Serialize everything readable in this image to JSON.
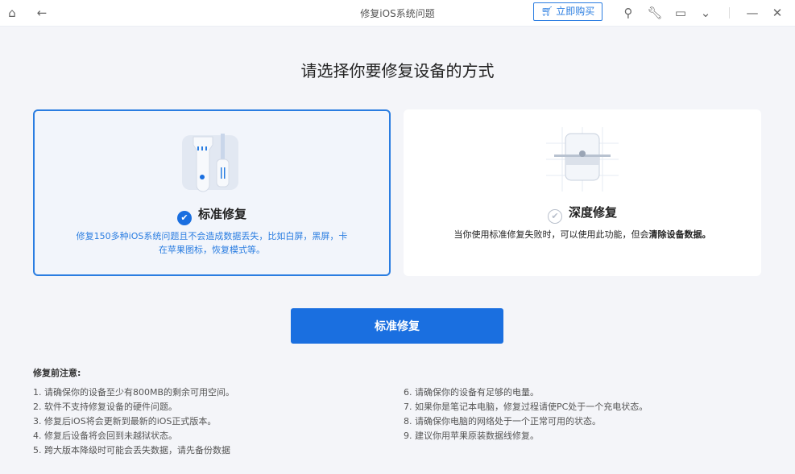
{
  "titlebar": {
    "title": "修复iOS系统问题",
    "buy_label": "立即购买",
    "icons": [
      "home-icon",
      "back-icon",
      "cart-icon",
      "key-icon",
      "wrench-icon",
      "feedback-icon",
      "chevron-down-icon",
      "minimize-icon",
      "close-icon"
    ]
  },
  "heading": "请选择你要修复设备的方式",
  "cards": [
    {
      "name": "标准修复",
      "desc": "修复150多种iOS系统问题且不会造成数据丢失，比如白屏，黑屏，卡在苹果图标，恢复模式等。",
      "selected": true
    },
    {
      "name": "深度修复",
      "desc": "当你使用标准修复失败时，可以使用此功能，但会",
      "desc_bold": "清除设备数据。",
      "selected": false
    }
  ],
  "action_label": "标准修复",
  "notes": {
    "title": "修复前注意:",
    "left": [
      "1.  请确保你的设备至少有800MB的剩余可用空间。",
      "2.  软件不支持修复设备的硬件问题。",
      "3.  修复后iOS将会更新到最新的iOS正式版本。",
      "4.  修复后设备将会回到未越狱状态。",
      "5.  跨大版本降级时可能会丢失数据，请先备份数据"
    ],
    "right": [
      "6.  请确保你的设备有足够的电量。",
      "7.  如果你是笔记本电脑，修复过程请使PC处于一个充电状态。",
      "8.  请确保你电脑的网络处于一个正常可用的状态。",
      "9.  建议你用苹果原装数据线修复。"
    ]
  },
  "colors": {
    "accent": "#1a6fe0"
  }
}
